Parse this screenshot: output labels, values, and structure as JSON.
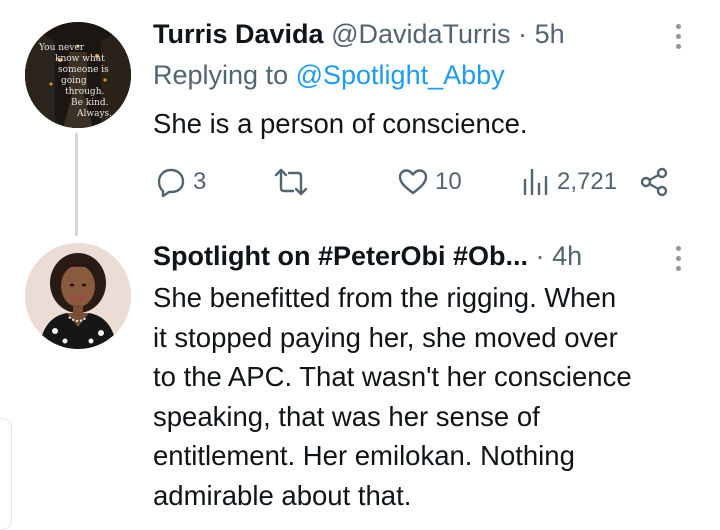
{
  "tweet1": {
    "name": "Turris Davida",
    "handle": "@DavidaTurris",
    "separator": "·",
    "time": "5h",
    "replying_prefix": "Replying to",
    "replying_mention": "@Spotlight_Abby",
    "text": "She is a person of conscience.",
    "avatar_text": [
      "You never",
      "know what",
      "someone is",
      "going",
      "through.",
      "Be kind.",
      "Always."
    ],
    "actions": {
      "replies": "3",
      "likes": "10",
      "views": "2,721"
    },
    "icons": [
      "reply-icon",
      "retweet-icon",
      "like-icon",
      "views-icon",
      "share-icon",
      "more-icon"
    ]
  },
  "tweet2": {
    "name": "Spotlight on #PeterObi #Ob...",
    "separator": "·",
    "time": "4h",
    "text_lines": [
      "She benefitted from the rigging. When",
      "it stopped paying her, she moved over",
      "to the APC. That wasn't her conscience",
      "speaking, that was her sense of",
      "entitlement. Her emilokan. Nothing",
      "admirable about that."
    ]
  },
  "colors": {
    "text": "#0f1419",
    "secondary": "#536471",
    "link": "#1d9bf0",
    "thread_line": "#cfd9de"
  }
}
